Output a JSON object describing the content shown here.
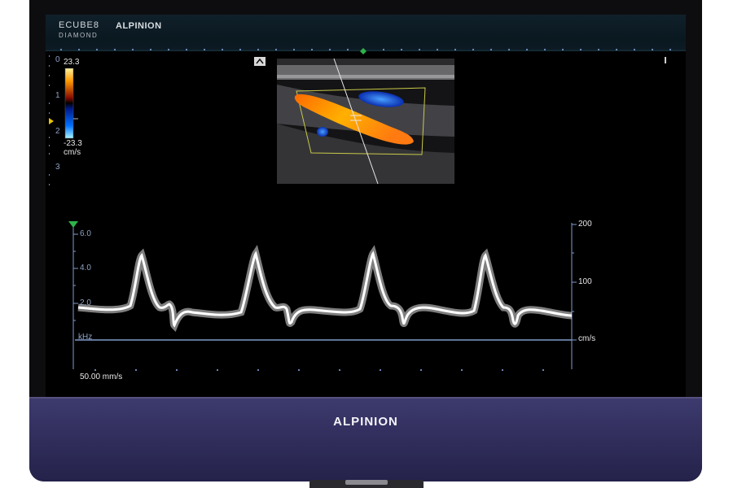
{
  "monitor": {
    "bezel_brand": "ALPINION"
  },
  "header": {
    "logo_line1": "ECUBE8",
    "logo_line2": "DIAMOND",
    "title": "ALPINION"
  },
  "depth_scale": {
    "ticks": [
      "0",
      "1",
      "2",
      "3"
    ]
  },
  "color_bar": {
    "max_label": "23.3",
    "min_label": "-23.3",
    "unit": "cm/s"
  },
  "doppler": {
    "left_axis": {
      "ticks": [
        "6.0",
        "4.0",
        "2.0"
      ],
      "unit": "kHz"
    },
    "right_axis": {
      "ticks": [
        "200",
        "100"
      ],
      "unit": "cm/s"
    },
    "sweep_speed": "50.00 mm/s"
  },
  "colors": {
    "accent": "#7f9ccc",
    "marker": "#2fb24a",
    "bezel": "#35326a"
  }
}
